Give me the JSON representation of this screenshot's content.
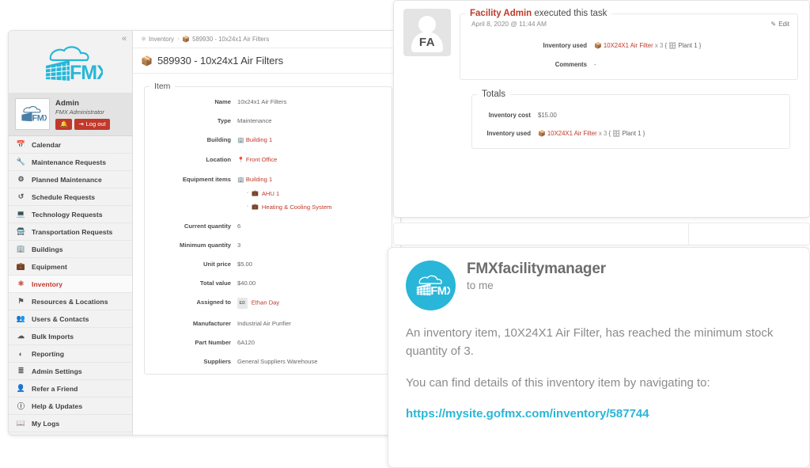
{
  "app": {
    "collapse_icon": "«",
    "logo_text": "FMX",
    "profile": {
      "name": "Admin",
      "role": "FMX Administrator",
      "bell_icon": "bell-icon",
      "logout_label": "Log out",
      "logout_icon": "logout-icon"
    },
    "nav": [
      {
        "label": "Calendar",
        "icon": "calendar-icon",
        "glyph": "▦",
        "active": false
      },
      {
        "label": "Maintenance Requests",
        "icon": "wrench-icon",
        "glyph": "🔧",
        "active": false
      },
      {
        "label": "Planned Maintenance",
        "icon": "gears-icon",
        "glyph": "⚙",
        "active": false
      },
      {
        "label": "Schedule Requests",
        "icon": "history-icon",
        "glyph": "↺",
        "active": false
      },
      {
        "label": "Technology Requests",
        "icon": "laptop-icon",
        "glyph": "▭",
        "active": false
      },
      {
        "label": "Transportation Requests",
        "icon": "bus-icon",
        "glyph": "▤",
        "active": false
      },
      {
        "label": "Buildings",
        "icon": "building-icon",
        "glyph": "▥",
        "active": false
      },
      {
        "label": "Equipment",
        "icon": "briefcase-icon",
        "glyph": "▬",
        "active": false
      },
      {
        "label": "Inventory",
        "icon": "inventory-icon",
        "glyph": "⚛",
        "active": true
      },
      {
        "label": "Resources & Locations",
        "icon": "flag-icon",
        "glyph": "⚑",
        "active": false
      },
      {
        "label": "Users & Contacts",
        "icon": "users-icon",
        "glyph": "👥",
        "active": false
      },
      {
        "label": "Bulk Imports",
        "icon": "cloud-upload-icon",
        "glyph": "☁",
        "active": false
      },
      {
        "label": "Reporting",
        "icon": "pie-chart-icon",
        "glyph": "◕",
        "active": false
      },
      {
        "label": "Admin Settings",
        "icon": "sliders-icon",
        "glyph": "≡",
        "active": false
      },
      {
        "label": "Refer a Friend",
        "icon": "user-plus-icon",
        "glyph": "👤",
        "active": false
      },
      {
        "label": "Help & Updates",
        "icon": "question-circle-icon",
        "glyph": "?",
        "active": false
      },
      {
        "label": "My Logs",
        "icon": "book-icon",
        "glyph": "▯",
        "active": false
      }
    ]
  },
  "breadcrumb": {
    "root_label": "Inventory",
    "root_icon": "inventory-icon",
    "separator": "›",
    "current_label": "589930 - 10x24x1 Air Filters",
    "current_icon": "box-icon"
  },
  "page": {
    "title": "589930 - 10x24x1 Air Filters",
    "title_icon": "box-icon"
  },
  "item_card": {
    "legend": "Item",
    "fields": {
      "name_label": "Name",
      "name_value": "10x24x1 Air Filters",
      "type_label": "Type",
      "type_value": "Maintenance",
      "building_label": "Building",
      "building_value": "Building 1",
      "location_label": "Location",
      "location_value": "Front Office",
      "equipment_label": "Equipment items",
      "equipment_root": "Building 1",
      "equipment_child_1": "AHU 1",
      "equipment_child_2": "Heating & Cooling System",
      "current_qty_label": "Current quantity",
      "current_qty_value": "6",
      "min_qty_label": "Minimum quantity",
      "min_qty_value": "3",
      "unit_price_label": "Unit price",
      "unit_price_value": "$5.00",
      "total_value_label": "Total value",
      "total_value_value": "$40.00",
      "assigned_label": "Assigned to",
      "assigned_initials": "ED",
      "assigned_value": "Ethan Day",
      "manufacturer_label": "Manufacturer",
      "manufacturer_value": "Industrial Air Purifier",
      "part_number_label": "Part Number",
      "part_number_value": "6A120",
      "suppliers_label": "Suppliers",
      "suppliers_value": "General Suppliers Warehouse"
    }
  },
  "task_panel": {
    "avatar_initials": "FA",
    "executor": "Facility Admin",
    "legend_rest": " executed this task",
    "date": "April 8, 2020 @ 11:44 AM",
    "edit_label": "Edit",
    "edit_icon": "pencil-square-icon",
    "inventory_used_label": "Inventory used",
    "inventory_used_item": "10X24X1 Air Filter",
    "inventory_used_qty": "x 3",
    "inventory_used_location": "{ 🗄 Plant 1 }",
    "comments_label": "Comments",
    "comments_value": "-"
  },
  "totals_card": {
    "legend": "Totals",
    "cost_label": "Inventory cost",
    "cost_value": "$15.00",
    "used_label": "Inventory used",
    "used_item": "10X24X1 Air Filter",
    "used_qty": "x 3",
    "used_location": "{ 🗄 Plant 1 }"
  },
  "email": {
    "sender": "FMXfacilitymanager",
    "to": "to me",
    "logo_text": "FMX",
    "paragraph_1": "An inventory item, 10X24X1 Air Filter, has reached the minimum stock quantity of 3.",
    "paragraph_2": "You can find details of this inventory item by navigating to:",
    "link": "https://mysite.gofmx.com/inventory/587744"
  },
  "colors": {
    "brand_red": "#c0392b",
    "brand_cyan": "#29b6d8",
    "sidebar_bg": "#f2f2f2",
    "text": "#666666"
  }
}
